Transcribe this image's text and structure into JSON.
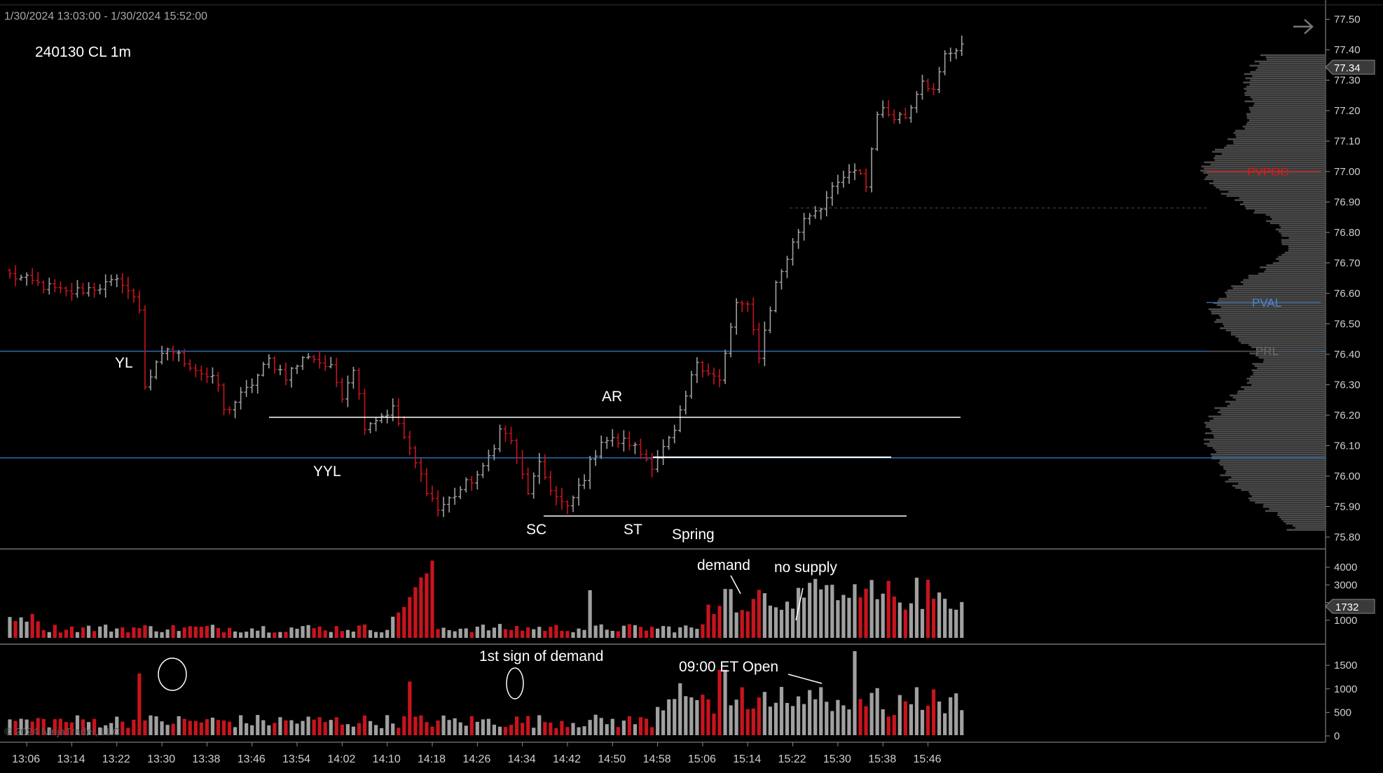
{
  "header": {
    "range": "1/30/2024 13:03:00 - 1/30/2024 15:52:00",
    "instrument": "240130 CL 1m"
  },
  "copyright": "© 2024 NinjaTrader, LLC",
  "colors": {
    "up": "#a0a0a0",
    "down": "#c8141e",
    "profile": "#4a4a4a",
    "blue_line": "#2f6bb3",
    "pvpoc": "#e01818"
  },
  "icons": {
    "nav": "arrow-right-icon"
  },
  "chart_data": [
    {
      "type": "candlestick",
      "ylim": [
        75.78,
        77.55
      ],
      "yticks": [
        "77.50",
        "77.40",
        "77.30",
        "77.20",
        "77.10",
        "77.00",
        "76.90",
        "76.80",
        "76.70",
        "76.60",
        "76.50",
        "76.40",
        "76.30",
        "76.20",
        "76.10",
        "76.00",
        "75.90",
        "75.80"
      ],
      "price_marker": "77.34",
      "x_labels": [
        "13:06",
        "13:14",
        "13:22",
        "13:30",
        "13:38",
        "13:46",
        "13:54",
        "14:02",
        "14:10",
        "14:18",
        "14:26",
        "14:34",
        "14:42",
        "14:50",
        "14:58",
        "15:06",
        "15:14",
        "15:22",
        "15:30",
        "15:38",
        "15:46"
      ],
      "start_time": "13:03",
      "waypoints": [
        [
          0,
          76.66
        ],
        [
          10,
          76.6
        ],
        [
          20,
          76.64
        ],
        [
          23,
          76.55
        ],
        [
          24,
          76.3
        ],
        [
          28,
          76.42
        ],
        [
          37,
          76.3
        ],
        [
          38,
          76.21
        ],
        [
          42,
          76.28
        ],
        [
          46,
          76.38
        ],
        [
          49,
          76.33
        ],
        [
          53,
          76.4
        ],
        [
          57,
          76.35
        ],
        [
          59,
          76.27
        ],
        [
          61,
          76.36
        ],
        [
          63,
          76.17
        ],
        [
          68,
          76.22
        ],
        [
          71,
          76.08
        ],
        [
          74,
          75.96
        ],
        [
          76,
          75.89
        ],
        [
          79,
          75.94
        ],
        [
          84,
          76.02
        ],
        [
          87,
          76.15
        ],
        [
          89,
          76.12
        ],
        [
          90,
          76.05
        ],
        [
          92,
          75.95
        ],
        [
          94,
          76.03
        ],
        [
          97,
          75.93
        ],
        [
          99,
          75.89
        ],
        [
          102,
          76.0
        ],
        [
          105,
          76.12
        ],
        [
          110,
          76.11
        ],
        [
          114,
          76.04
        ],
        [
          118,
          76.14
        ],
        [
          122,
          76.38
        ],
        [
          126,
          76.31
        ],
        [
          129,
          76.57
        ],
        [
          131,
          76.55
        ],
        [
          133,
          76.4
        ],
        [
          136,
          76.63
        ],
        [
          141,
          76.85
        ],
        [
          144,
          76.89
        ],
        [
          148,
          76.98
        ],
        [
          151,
          77.0
        ],
        [
          152,
          76.95
        ],
        [
          154,
          77.2
        ],
        [
          159,
          77.18
        ],
        [
          162,
          77.31
        ],
        [
          164,
          77.26
        ],
        [
          166,
          77.38
        ],
        [
          169,
          77.42
        ]
      ],
      "lines": [
        {
          "label": "YL",
          "price": 76.41
        },
        {
          "label": "YYL",
          "price": 76.06
        },
        {
          "label": "PVPOC",
          "price": 77.0
        },
        {
          "label": "PVAL",
          "price": 76.57
        },
        {
          "label": "PRL",
          "price": 76.41
        }
      ],
      "annotations": [
        "AR",
        "SC",
        "ST",
        "Spring"
      ]
    },
    {
      "type": "bar",
      "ylim": [
        0,
        4600
      ],
      "yticks": [
        "4000",
        "3000",
        "2000",
        "1000"
      ],
      "price_marker": "1732",
      "annotations": [
        "demand",
        "no supply"
      ]
    },
    {
      "type": "bar",
      "ylim": [
        0,
        1800
      ],
      "yticks": [
        "1500",
        "1000",
        "500",
        "0"
      ],
      "annotations": [
        "1st sign of demand",
        "09:00 ET Open"
      ]
    }
  ]
}
